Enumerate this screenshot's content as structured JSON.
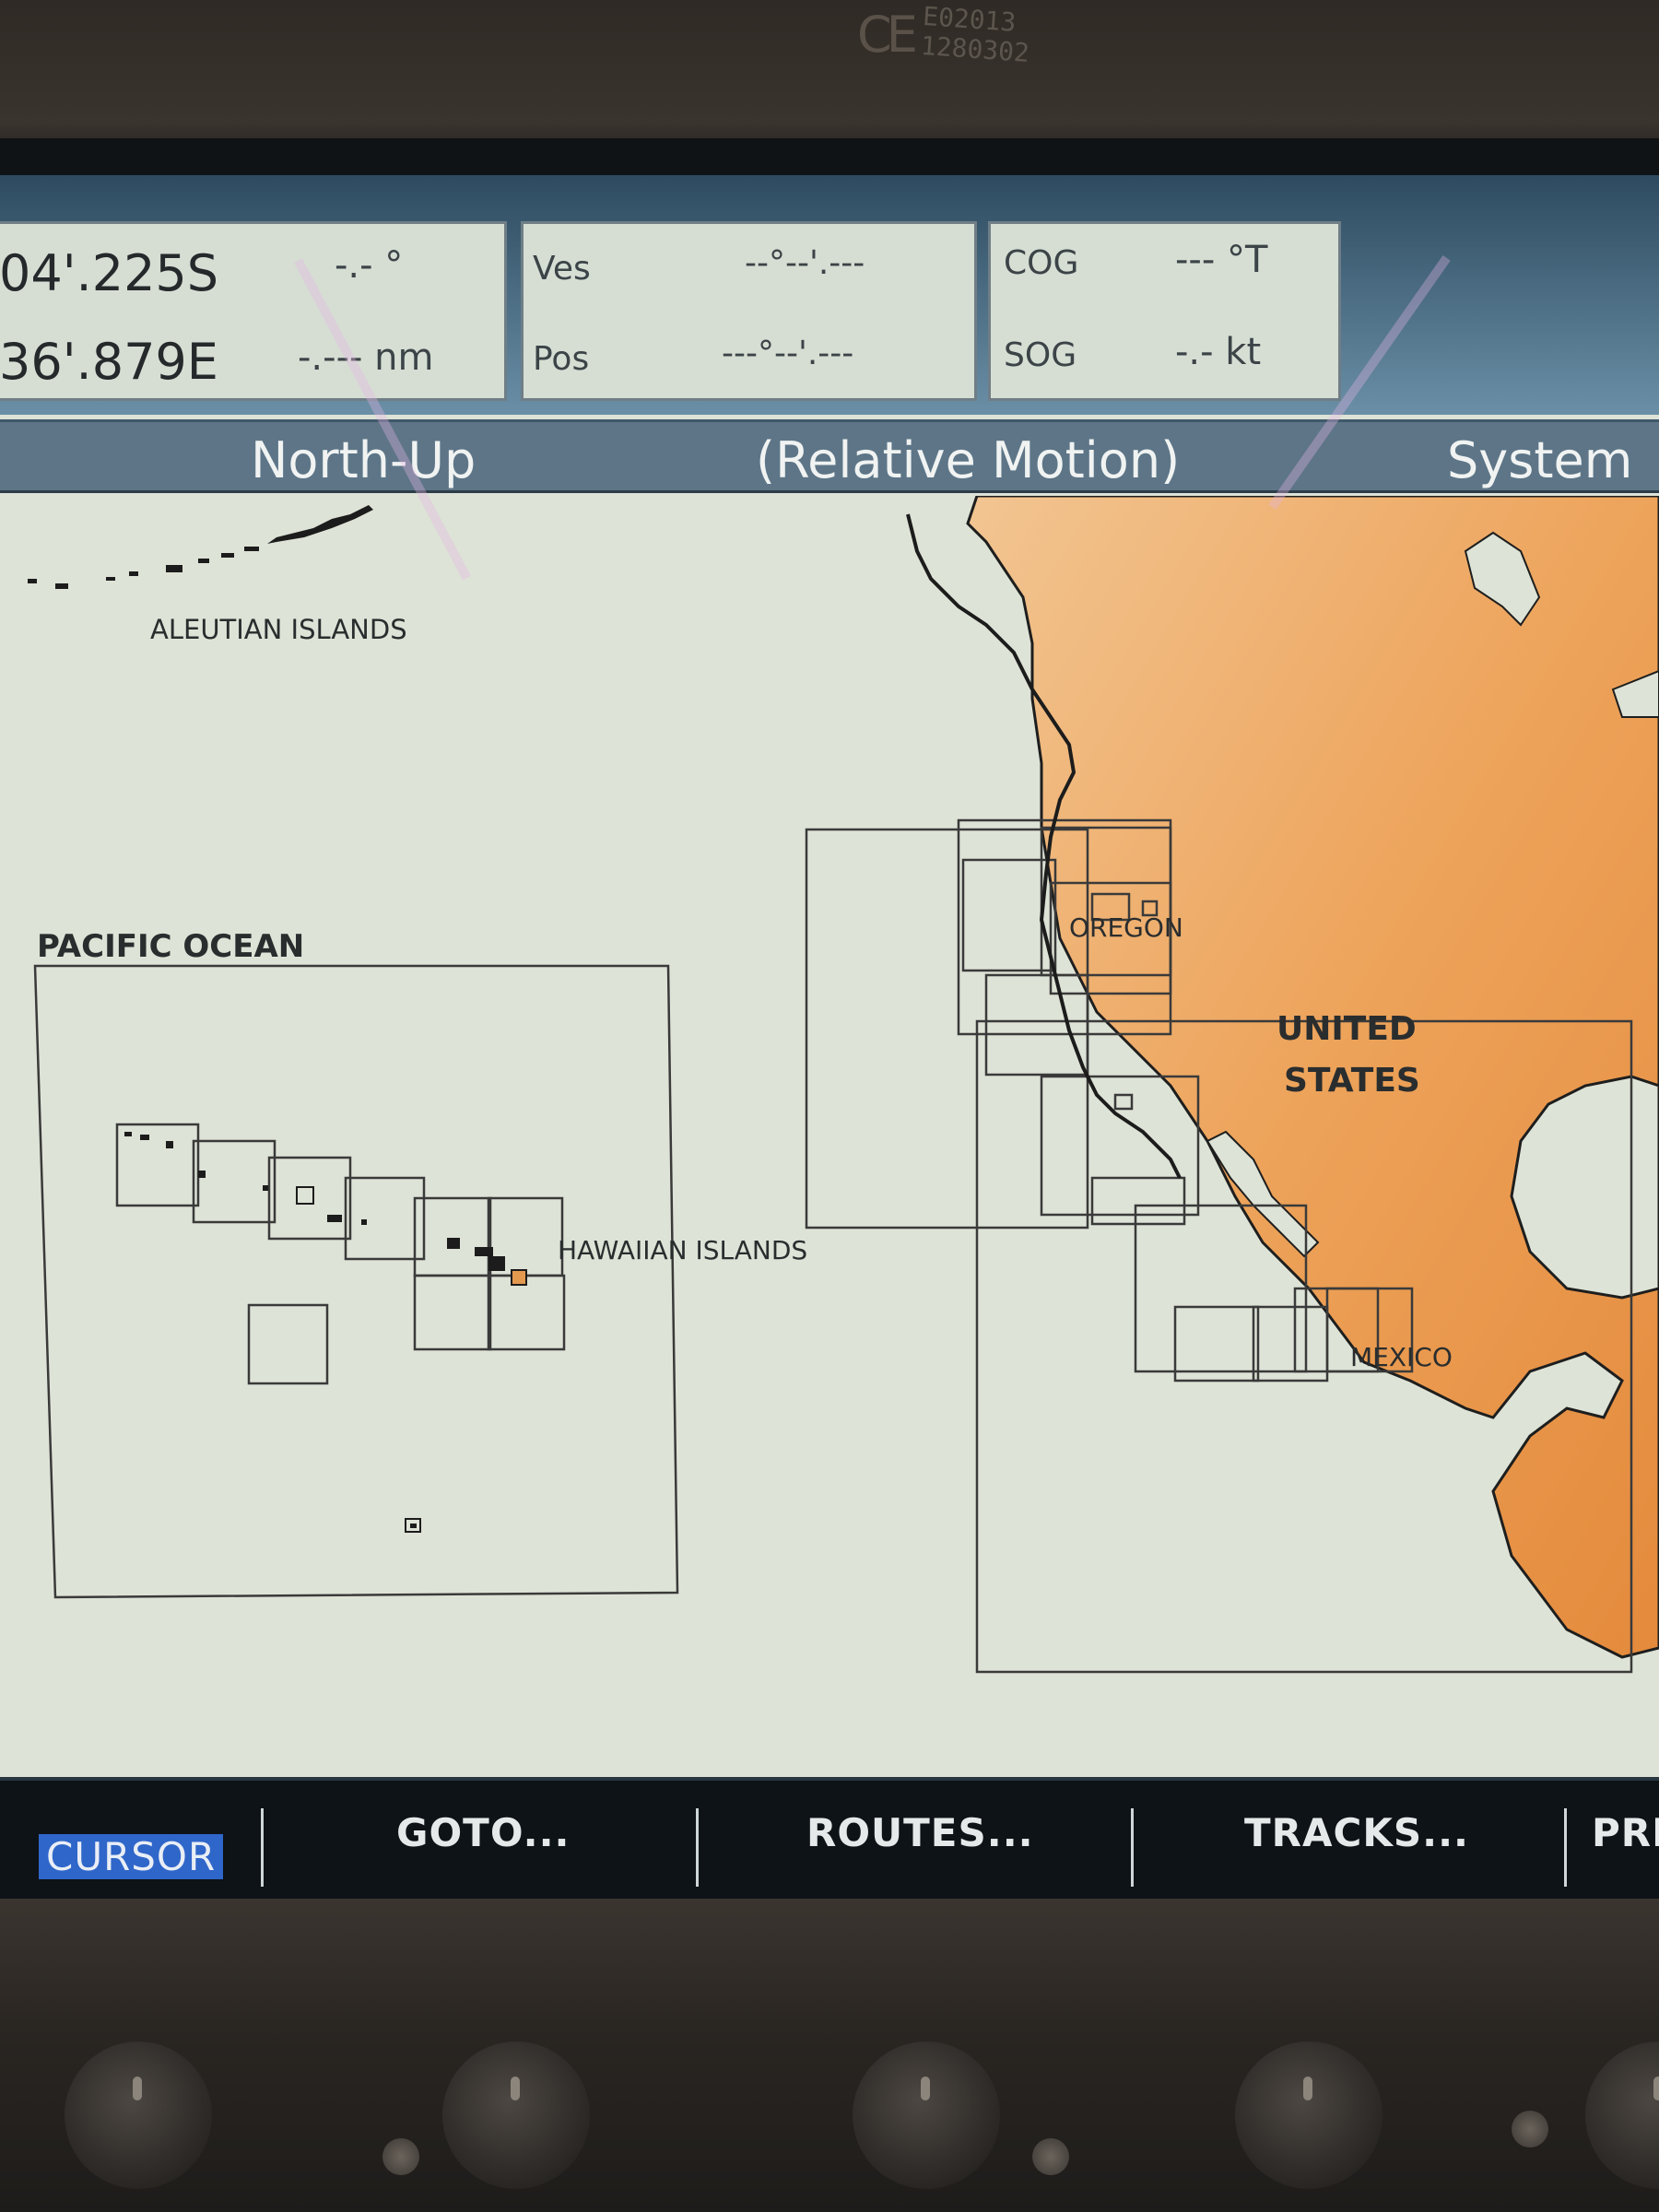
{
  "device": {
    "cert_mark": "CE",
    "serial_line1": "E02013",
    "serial_line2": "1280302"
  },
  "data_boxes": {
    "cursor": {
      "lat": "04'.225S",
      "lon": "36'.879E",
      "bearing": "-.- °",
      "range": "-.--- nm"
    },
    "vessel": {
      "label_1": "Ves",
      "label_2": "Pos",
      "lat": "--°--'.---",
      "lon": "---°--'.---"
    },
    "motion": {
      "cog_label": "COG",
      "cog_value": "--- °T",
      "sog_label": "SOG",
      "sog_value": "-.- kt"
    }
  },
  "status_bar": {
    "orientation": "North-Up",
    "motion_mode": "(Relative Motion)",
    "source": "System"
  },
  "map": {
    "labels": {
      "aleutian": "ALEUTIAN ISLANDS",
      "pacific": "PACIFIC OCEAN",
      "hawaiian": "HAWAIIAN ISLANDS",
      "oregon": "OREGON",
      "united_1": "UNITED",
      "united_2": "STATES",
      "mexico": "MEXICO"
    },
    "colors": {
      "water": "#dde3d6",
      "land": "#eda35a",
      "chart_outline": "#3a3a3a"
    }
  },
  "softkeys": {
    "cursor": "CURSOR",
    "goto": "GOTO...",
    "routes": "ROUTES...",
    "tracks": "TRACKS...",
    "partial": "PRI"
  }
}
